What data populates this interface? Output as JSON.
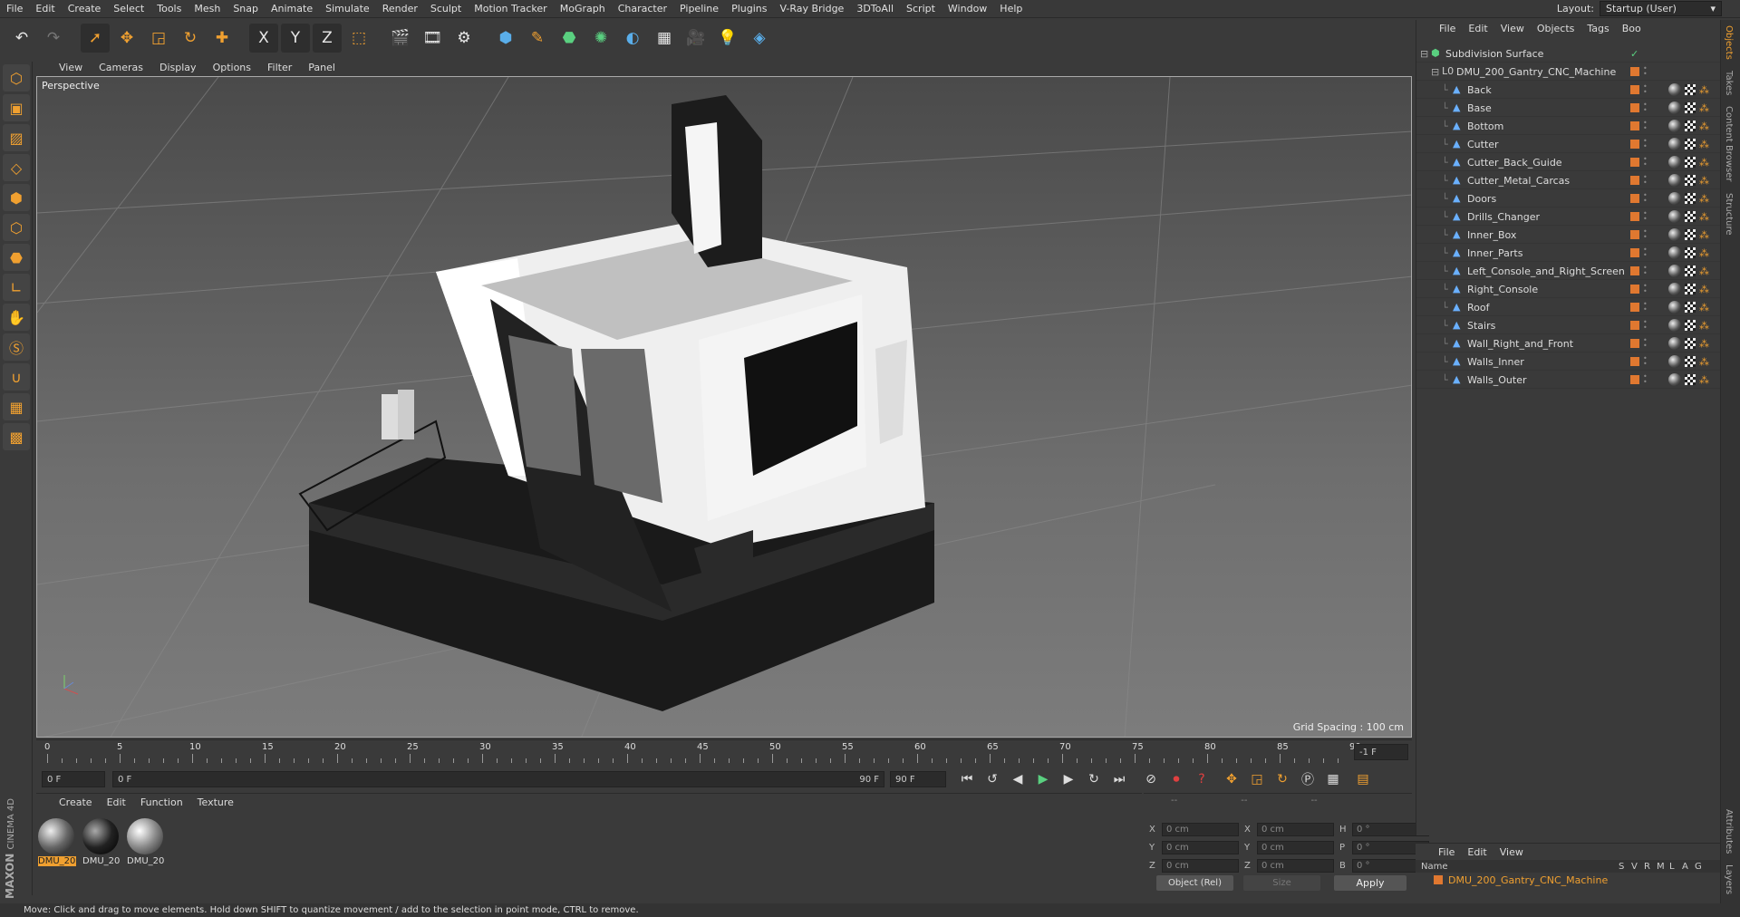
{
  "menubar": {
    "items": [
      "File",
      "Edit",
      "Create",
      "Select",
      "Tools",
      "Mesh",
      "Snap",
      "Animate",
      "Simulate",
      "Render",
      "Sculpt",
      "Motion Tracker",
      "MoGraph",
      "Character",
      "Pipeline",
      "Plugins",
      "V-Ray Bridge",
      "3DToAll",
      "Script",
      "Window",
      "Help"
    ],
    "layout_label": "Layout:",
    "layout_value": "Startup (User)"
  },
  "toolbar": {
    "icons": [
      "undo-icon",
      "redo-icon",
      "select-icon",
      "move-icon",
      "scale-icon",
      "rotate-icon",
      "add-icon",
      "x-axis-icon",
      "y-axis-icon",
      "z-axis-icon",
      "coord-system-icon",
      "render-view-icon",
      "render-region-icon",
      "render-settings-icon",
      "cube-icon",
      "pen-icon",
      "nurbs-icon",
      "array-icon",
      "deformer-icon",
      "floor-icon",
      "camera-icon",
      "light-icon",
      "python-icon"
    ],
    "axis_labels": [
      "X",
      "Y",
      "Z"
    ]
  },
  "viewport": {
    "menu": [
      "View",
      "Cameras",
      "Display",
      "Options",
      "Filter",
      "Panel"
    ],
    "label": "Perspective",
    "grid_spacing": "Grid Spacing : 100 cm"
  },
  "timeline": {
    "ticks": [
      "0",
      "5",
      "10",
      "15",
      "20",
      "25",
      "30",
      "35",
      "40",
      "45",
      "50",
      "55",
      "60",
      "65",
      "70",
      "75",
      "80",
      "85",
      "90"
    ],
    "current_frame": "-1 F",
    "start_field": "0 F",
    "range_start": "0 F",
    "range_end": "90 F",
    "end_field": "90 F"
  },
  "materials": {
    "menu": [
      "Create",
      "Edit",
      "Function",
      "Texture"
    ],
    "items": [
      {
        "label": "DMU_20"
      },
      {
        "label": "DMU_20"
      },
      {
        "label": "DMU_20"
      }
    ]
  },
  "coords": {
    "headers": [
      "--",
      "--",
      "--"
    ],
    "rows": [
      {
        "a": "X",
        "v1": "0 cm",
        "b": "X",
        "v2": "0 cm",
        "c": "H",
        "v3": "0 °"
      },
      {
        "a": "Y",
        "v1": "0 cm",
        "b": "Y",
        "v2": "0 cm",
        "c": "P",
        "v3": "0 °"
      },
      {
        "a": "Z",
        "v1": "0 cm",
        "b": "Z",
        "v2": "0 cm",
        "c": "B",
        "v3": "0 °"
      }
    ],
    "object_mode": "Object (Rel)",
    "size_mode": "Size",
    "apply": "Apply"
  },
  "objects": {
    "menu": [
      "File",
      "Edit",
      "View",
      "Objects",
      "Tags",
      "Boo"
    ],
    "root": "Subdivision Surface",
    "group": "DMU_200_Gantry_CNC_Machine",
    "children": [
      "Back",
      "Base",
      "Bottom",
      "Cutter",
      "Cutter_Back_Guide",
      "Cutter_Metal_Carcas",
      "Doors",
      "Drills_Changer",
      "Inner_Box",
      "Inner_Parts",
      "Left_Console_and_Right_Screen",
      "Right_Console",
      "Roof",
      "Stairs",
      "Wall_Right_and_Front",
      "Walls_Inner",
      "Walls_Outer"
    ]
  },
  "layers": {
    "menu": [
      "File",
      "Edit",
      "View"
    ],
    "header": {
      "name": "Name",
      "cols": [
        "S",
        "V",
        "R",
        "M",
        "L",
        "A",
        "G"
      ]
    },
    "row": "DMU_200_Gantry_CNC_Machine"
  },
  "right_tabs": [
    "Objects",
    "Takes",
    "Content Browser",
    "Structure"
  ],
  "right_tabs_bottom": [
    "Attributes",
    "Layers"
  ],
  "logo": {
    "line1": "MAXON",
    "line2": "CINEMA 4D"
  },
  "status": "Move: Click and drag to move elements. Hold down SHIFT to quantize movement / add to the selection in point mode, CTRL to remove.",
  "colors": {
    "accent": "#f0a030",
    "panel": "#3a3a3a",
    "selection": "#e07830"
  }
}
